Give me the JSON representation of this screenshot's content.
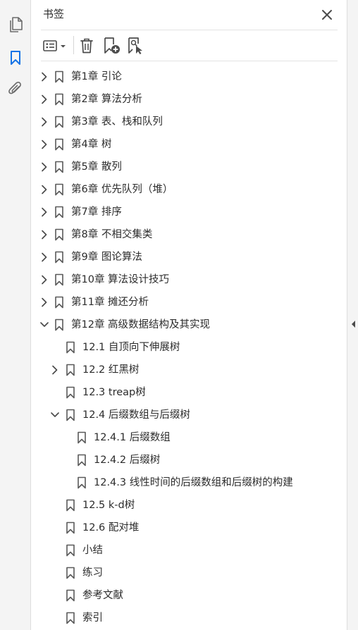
{
  "panel": {
    "title": "书签",
    "accent_color": "#1473e6"
  },
  "rail": {
    "icons": [
      "pages-icon",
      "bookmarks-icon",
      "attachments-icon"
    ],
    "active": "bookmarks-icon"
  },
  "toolbar": {
    "icons": [
      "options-menu-icon",
      "delete-bookmark-icon",
      "new-bookmark-icon",
      "find-bookmark-icon"
    ]
  },
  "bookmarks": [
    {
      "label": "第1章 引论",
      "level": 0,
      "expander": "collapsed"
    },
    {
      "label": "第2章 算法分析",
      "level": 0,
      "expander": "collapsed"
    },
    {
      "label": "第3章 表、栈和队列",
      "level": 0,
      "expander": "collapsed"
    },
    {
      "label": "第4章 树",
      "level": 0,
      "expander": "collapsed"
    },
    {
      "label": "第5章 散列",
      "level": 0,
      "expander": "collapsed"
    },
    {
      "label": "第6章 优先队列（堆）",
      "level": 0,
      "expander": "collapsed"
    },
    {
      "label": "第7章 排序",
      "level": 0,
      "expander": "collapsed"
    },
    {
      "label": "第8章 不相交集类",
      "level": 0,
      "expander": "collapsed"
    },
    {
      "label": "第9章 图论算法",
      "level": 0,
      "expander": "collapsed"
    },
    {
      "label": "第10章 算法设计技巧",
      "level": 0,
      "expander": "collapsed"
    },
    {
      "label": "第11章 摊还分析",
      "level": 0,
      "expander": "collapsed"
    },
    {
      "label": "第12章 高级数据结构及其实现",
      "level": 0,
      "expander": "expanded"
    },
    {
      "label": "12.1 自顶向下伸展树",
      "level": 1,
      "expander": "none"
    },
    {
      "label": "12.2 红黑树",
      "level": 1,
      "expander": "collapsed"
    },
    {
      "label": "12.3 treap树",
      "level": 1,
      "expander": "none"
    },
    {
      "label": "12.4 后缀数组与后缀树",
      "level": 1,
      "expander": "expanded"
    },
    {
      "label": "12.4.1 后缀数组",
      "level": 2,
      "expander": "none"
    },
    {
      "label": "12.4.2 后缀树",
      "level": 2,
      "expander": "none"
    },
    {
      "label": "12.4.3 线性时间的后缀数组和后缀树的构建",
      "level": 2,
      "expander": "none"
    },
    {
      "label": "12.5 k-d树",
      "level": 1,
      "expander": "none"
    },
    {
      "label": "12.6 配对堆",
      "level": 1,
      "expander": "none"
    },
    {
      "label": "小结",
      "level": 1,
      "expander": "none"
    },
    {
      "label": "练习",
      "level": 1,
      "expander": "none"
    },
    {
      "label": "参考文献",
      "level": 1,
      "expander": "none"
    },
    {
      "label": "索引",
      "level": 1,
      "expander": "none"
    }
  ]
}
